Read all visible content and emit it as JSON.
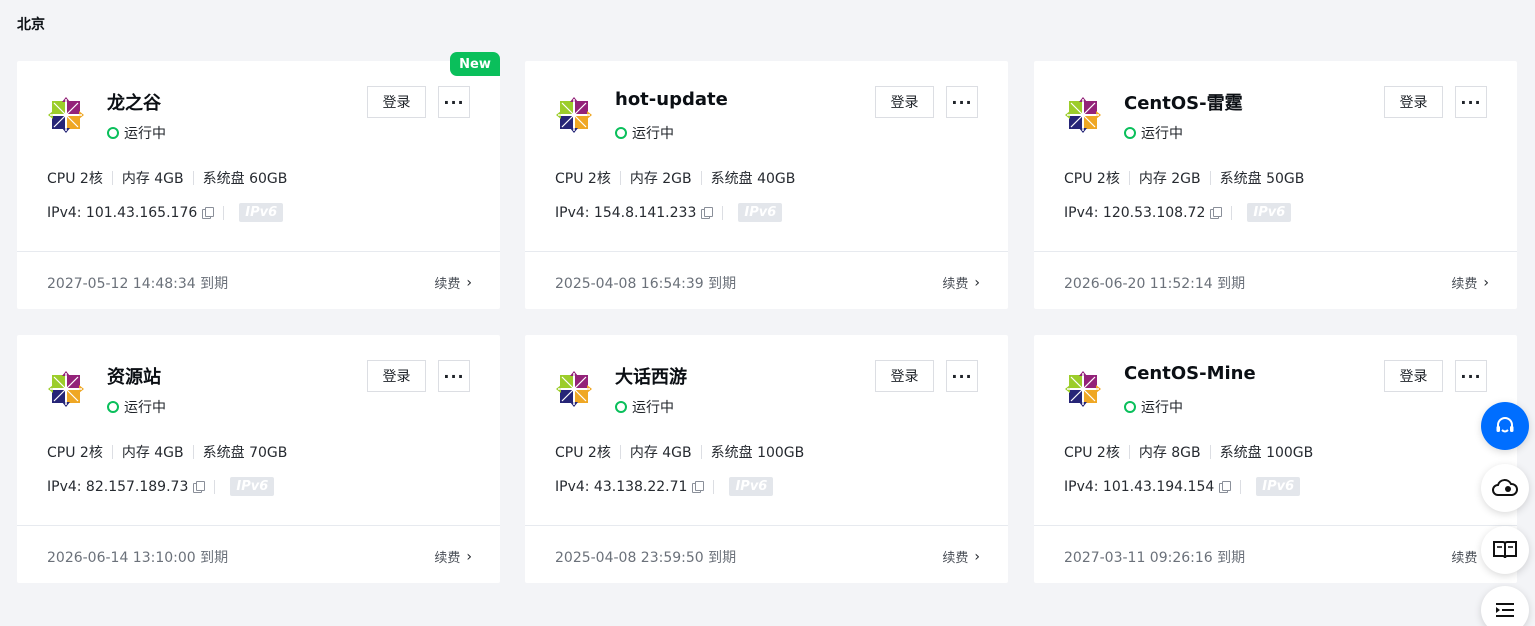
{
  "region": "北京",
  "new_badge": "New",
  "login_label": "登录",
  "more_label": "···",
  "renew_label": "续费",
  "ipv6_label": "IPv6",
  "icons": {
    "os_logo": "centos-logo-icon",
    "copy": "copy-icon",
    "chevron": "chevron-right-icon",
    "support": "headset-support-icon",
    "cloud": "cloud-bell-icon",
    "docs": "book-icon",
    "menu": "collapse-menu-icon"
  },
  "colors": {
    "status_running": "#0abf5b",
    "primary": "#006eff"
  },
  "instances": [
    {
      "name": "龙之谷",
      "status": "运行中",
      "cpu": "CPU 2核",
      "mem": "内存 4GB",
      "disk": "系统盘 60GB",
      "ipv4": "IPv4: 101.43.165.176",
      "expire": "2027-05-12 14:48:34 到期"
    },
    {
      "name": "hot-update",
      "status": "运行中",
      "cpu": "CPU 2核",
      "mem": "内存 2GB",
      "disk": "系统盘 40GB",
      "ipv4": "IPv4: 154.8.141.233",
      "expire": "2025-04-08 16:54:39 到期"
    },
    {
      "name": "CentOS-雷霆",
      "status": "运行中",
      "cpu": "CPU 2核",
      "mem": "内存 2GB",
      "disk": "系统盘 50GB",
      "ipv4": "IPv4: 120.53.108.72",
      "expire": "2026-06-20 11:52:14 到期"
    },
    {
      "name": "资源站",
      "status": "运行中",
      "cpu": "CPU 2核",
      "mem": "内存 4GB",
      "disk": "系统盘 70GB",
      "ipv4": "IPv4: 82.157.189.73",
      "expire": "2026-06-14 13:10:00 到期"
    },
    {
      "name": "大话西游",
      "status": "运行中",
      "cpu": "CPU 2核",
      "mem": "内存 4GB",
      "disk": "系统盘 100GB",
      "ipv4": "IPv4: 43.138.22.71",
      "expire": "2025-04-08 23:59:50 到期"
    },
    {
      "name": "CentOS-Mine",
      "status": "运行中",
      "cpu": "CPU 2核",
      "mem": "内存 8GB",
      "disk": "系统盘 100GB",
      "ipv4": "IPv4: 101.43.194.154",
      "expire": "2027-03-11 09:26:16 到期"
    }
  ]
}
